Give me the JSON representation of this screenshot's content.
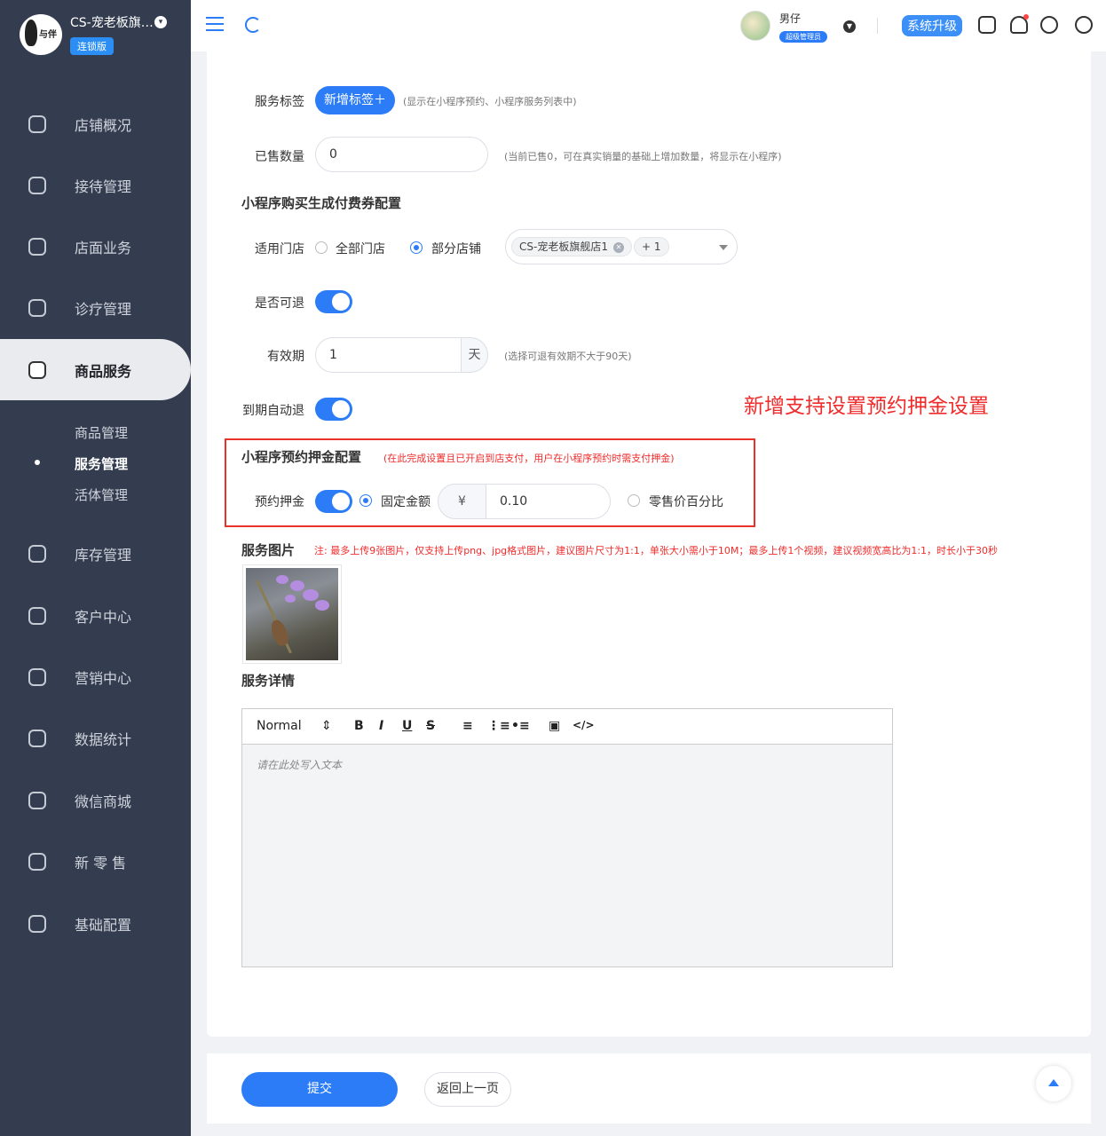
{
  "sidebar": {
    "logo_text": "与伴",
    "store_name": "CS-宠老板旗…",
    "edition": "连锁版",
    "items": [
      {
        "label": "店铺概况",
        "icon": "monitor-icon"
      },
      {
        "label": "接待管理",
        "icon": "clipboard-edit-icon"
      },
      {
        "label": "店面业务",
        "icon": "home-icon"
      },
      {
        "label": "诊疗管理",
        "icon": "medical-kit-icon"
      },
      {
        "label": "商品服务",
        "icon": "shopping-bag-icon"
      },
      {
        "label": "库存管理",
        "icon": "inventory-box-icon"
      },
      {
        "label": "客户中心",
        "icon": "user-badge-icon"
      },
      {
        "label": "营销中心",
        "icon": "bar-chart-icon"
      },
      {
        "label": "数据统计",
        "icon": "trend-chart-icon"
      },
      {
        "label": "微信商城",
        "icon": "wechat-icon"
      },
      {
        "label": "新 零 售",
        "icon": "cube-icon"
      },
      {
        "label": "基础配置",
        "icon": "settings-icon"
      }
    ],
    "sub_items": [
      {
        "label": "商品管理"
      },
      {
        "label": "服务管理"
      },
      {
        "label": "活体管理"
      }
    ]
  },
  "topbar": {
    "user_name": "男仔",
    "user_role": "超级管理员",
    "upgrade_label": "系统升级"
  },
  "form": {
    "service_tag_label": "服务标签",
    "add_tag_button": "新增标签＋",
    "service_tag_hint": "(显示在小程序预约、小程序服务列表中)",
    "sold_count_label": "已售数量",
    "sold_count_value": "0",
    "sold_count_hint": "(当前已售0，可在真实销量的基础上增加数量，将显示在小程序)",
    "coupon_section_title": "小程序购买生成付费券配置",
    "applicable_store_label": "适用门店",
    "all_stores_option": "全部门店",
    "partial_stores_option": "部分店铺",
    "selected_store_tag": "CS-宠老板旗舰店1",
    "more_stores_tag": "+ 1",
    "refundable_label": "是否可退",
    "validity_label": "有效期",
    "validity_value": "1",
    "validity_unit": "天",
    "validity_hint": "(选择可退有效期不大于90天)",
    "auto_refund_label": "到期自动退",
    "annotation": "新增支持设置预约押金设置",
    "deposit_section_title": "小程序预约押金配置",
    "deposit_section_hint": "(在此完成设置且已开启到店支付，用户在小程序预约时需支付押金)",
    "deposit_label": "预约押金",
    "fixed_amount_option": "固定金额",
    "currency_symbol": "¥",
    "deposit_amount": "0.10",
    "percentage_option": "零售价百分比",
    "image_section_title": "服务图片",
    "image_hint": "注: 最多上传9张图片，仅支持上传png、jpg格式图片，建议图片尺寸为1:1，单张大小需小于10M；最多上传1个视频，建议视频宽高比为1:1，时长小于30秒",
    "detail_section_title": "服务详情",
    "editor_format": "Normal",
    "editor_placeholder": "请在此处写入文本"
  },
  "footer": {
    "submit_label": "提交",
    "back_label": "返回上一页"
  },
  "colors": {
    "primary": "#2b7cf6",
    "sidebar_bg": "#343d4f",
    "annotation_red": "#f02b2b"
  }
}
